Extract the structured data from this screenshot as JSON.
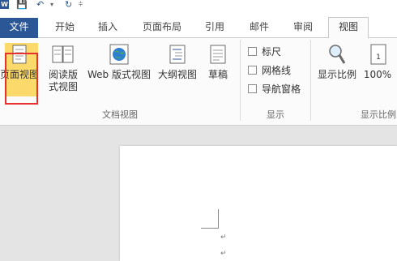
{
  "qat": {
    "app_letter": "W"
  },
  "tabs": {
    "file": "文件",
    "items": [
      {
        "label": "开始"
      },
      {
        "label": "插入"
      },
      {
        "label": "页面布局"
      },
      {
        "label": "引用"
      },
      {
        "label": "邮件"
      },
      {
        "label": "审阅"
      },
      {
        "label": "视图"
      }
    ],
    "active": "视图"
  },
  "ribbon": {
    "doc_views": {
      "group_label": "文档视图",
      "buttons": [
        {
          "label": "页面视图",
          "state": "selected"
        },
        {
          "label": "阅读版式视图"
        },
        {
          "label": "Web 版式视图"
        },
        {
          "label": "大纲视图"
        },
        {
          "label": "草稿"
        }
      ]
    },
    "show": {
      "group_label": "显示",
      "checkboxes": [
        {
          "label": "标尺",
          "checked": false
        },
        {
          "label": "网格线",
          "checked": false
        },
        {
          "label": "导航窗格",
          "checked": false
        }
      ]
    },
    "zoom": {
      "group_label": "显示比例",
      "buttons": [
        {
          "label": "显示比例"
        },
        {
          "label": "100%"
        }
      ]
    }
  },
  "colors": {
    "file_tab": "#2b5797",
    "selected_button": "#fbd96b",
    "highlight_border": "#e8312f"
  }
}
